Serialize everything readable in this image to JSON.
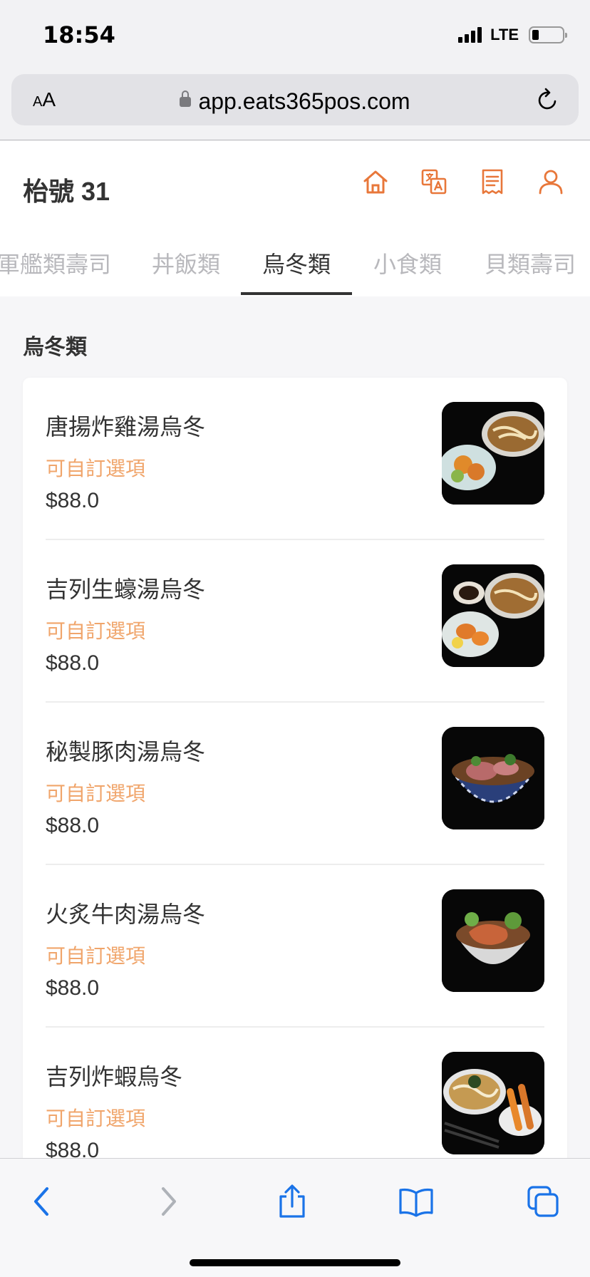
{
  "status_bar": {
    "time": "18:54",
    "network": "LTE"
  },
  "browser": {
    "text_size_label_small": "A",
    "text_size_label_large": "A",
    "url": "app.eats365pos.com"
  },
  "header": {
    "table_title": "枱號 31",
    "icons": [
      "home-icon",
      "translate-icon",
      "receipt-icon",
      "user-icon"
    ],
    "accent_color": "#e8773a"
  },
  "tabs": [
    {
      "label": "軍艦類壽司"
    },
    {
      "label": "丼飯類"
    },
    {
      "label": "烏冬類",
      "active": true
    },
    {
      "label": "小食類"
    },
    {
      "label": "貝類壽司"
    }
  ],
  "section": {
    "title": "烏冬類"
  },
  "items": [
    {
      "name": "唐揚炸雞湯烏冬",
      "option": "可自訂選項",
      "price": "$88.0"
    },
    {
      "name": "吉列生蠔湯烏冬",
      "option": "可自訂選項",
      "price": "$88.0"
    },
    {
      "name": "秘製豚肉湯烏冬",
      "option": "可自訂選項",
      "price": "$88.0"
    },
    {
      "name": "火炙牛肉湯烏冬",
      "option": "可自訂選項",
      "price": "$88.0"
    },
    {
      "name": "吉列炸蝦烏冬",
      "option": "可自訂選項",
      "price": "$88.0"
    }
  ],
  "toolbar": {
    "icons": [
      "back-icon",
      "forward-icon",
      "share-icon",
      "bookmarks-icon",
      "tabs-icon"
    ]
  }
}
